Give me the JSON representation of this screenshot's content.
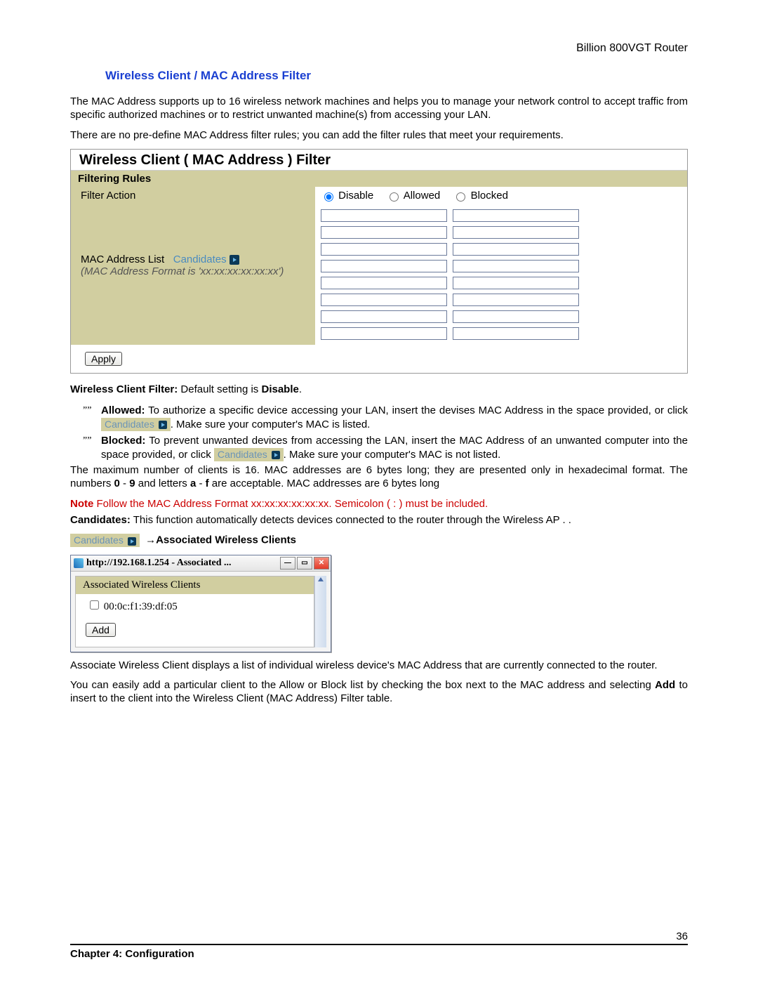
{
  "header": {
    "product": "Billion 800VGT Router"
  },
  "section_title": "Wireless Client / MAC Address Filter",
  "intro1": "The MAC Address supports up to 16 wireless network machines and helps you to manage your network control to accept traffic from specific authorized machines or to restrict unwanted machine(s) from accessing your LAN.",
  "intro2": "There are no pre-define MAC Address filter rules; you can add the filter rules that meet your requirements.",
  "panel": {
    "title": "Wireless Client ( MAC Address ) Filter",
    "subtitle": "Filtering Rules",
    "filter_action_label": "Filter Action",
    "opt_disable": "Disable",
    "opt_allowed": "Allowed",
    "opt_blocked": "Blocked",
    "mac_list_label": "MAC Address List",
    "candidates_label": "Candidates",
    "mac_fmt": "(MAC Address Format is 'xx:xx:xx:xx:xx:xx')",
    "apply": "Apply"
  },
  "wcf": {
    "label": "Wireless Client Filter:",
    "text": " Default setting is ",
    "val": "Disable"
  },
  "allowed": {
    "head": "Allowed:",
    "t1": " To authorize a specific device accessing your LAN, insert the devises MAC Address in the space provided, or click ",
    "t2": ".    Make sure your computer's MAC is listed."
  },
  "blocked": {
    "head": "Blocked:",
    "t1": " To prevent unwanted devices from accessing the LAN,   insert the MAC Address of an unwanted computer into the space provided, or click",
    "t2": ". Make sure your computer's MAC is not listed."
  },
  "max_clients": {
    "p1": "The maximum number of clients is 16. MAC addresses are 6 bytes long; they are presented only in hexadecimal format.   The numbers ",
    "n0": "0",
    "dash1": " - ",
    "n9": "9",
    "p2": " and letters ",
    "la": "a",
    "dash2": " - ",
    "lf": "f",
    "p3": " are acceptable. MAC addresses are 6 bytes long"
  },
  "note": {
    "label": "Note",
    "text": "   Follow the MAC Address Format xx:xx:xx:xx:xx:xx.    Semicolon ( : ) must be included."
  },
  "candidates_desc": {
    "label": "Candidates:",
    "text": "   This function automatically detects devices connected to the router through the Wireless AP . ."
  },
  "assoc_label": "→Associated Wireless Clients",
  "popup": {
    "title": "http://192.168.1.254 - Associated ...",
    "header": "Associated Wireless Clients",
    "client_mac": "00:0c:f1:39:df:05",
    "add": "Add"
  },
  "assoc_p1": "Associate Wireless Client displays a list of individual wireless device's MAC Address that are currently connected to the router.",
  "assoc_p2a": "You can easily add a particular client to the Allow or Block list by checking the box next to the MAC address and selecting ",
  "assoc_add": "Add",
  "assoc_p2b": " to insert to the client into the Wireless Client (MAC Address) Filter table.",
  "footer": {
    "page": "36",
    "chapter": "Chapter 4: Configuration"
  },
  "chip_text": "Candidates"
}
